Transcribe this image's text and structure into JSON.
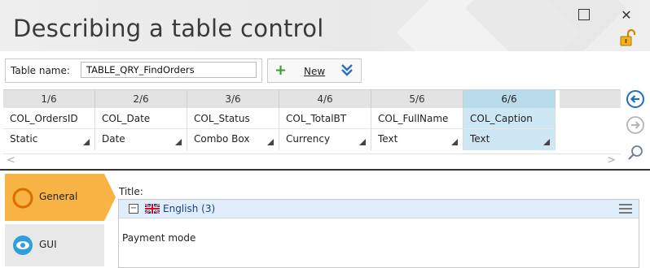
{
  "window": {
    "title": "Describing a table control",
    "maximize_label": "",
    "close_label": "✕"
  },
  "toolbar": {
    "table_name_label": "Table name:",
    "table_name_value": "TABLE_QRY_FindOrders",
    "new_label": "New"
  },
  "grid": {
    "columns": [
      {
        "index": "1/6",
        "name": "COL_OrdersID",
        "type": "Static"
      },
      {
        "index": "2/6",
        "name": "COL_Date",
        "type": "Date"
      },
      {
        "index": "3/6",
        "name": "COL_Status",
        "type": "Combo Box"
      },
      {
        "index": "4/6",
        "name": "COL_TotalBT",
        "type": "Currency"
      },
      {
        "index": "5/6",
        "name": "COL_FullName",
        "type": "Text"
      },
      {
        "index": "6/6",
        "name": "COL_Caption",
        "type": "Text"
      }
    ],
    "selected_index": 5,
    "scroll_left": "<",
    "scroll_right": ">"
  },
  "side_buttons": [
    "circle-arrow-left-icon",
    "circle-arrow-right-icon",
    "magnifier-icon"
  ],
  "tabs": [
    {
      "label": "General",
      "active": true,
      "icon": "general-circle-icon"
    },
    {
      "label": "GUI",
      "active": false,
      "icon": "eye-icon"
    }
  ],
  "details": {
    "title_label": "Title:",
    "language_label": "English (3)",
    "value": "Payment mode"
  },
  "colors": {
    "accent_orange": "#f7b343",
    "selected_column": "#cde8f4",
    "language_header": "#dfeefa",
    "plus_green": "#2fa12f",
    "arrow_blue": "#1f6fc6"
  }
}
